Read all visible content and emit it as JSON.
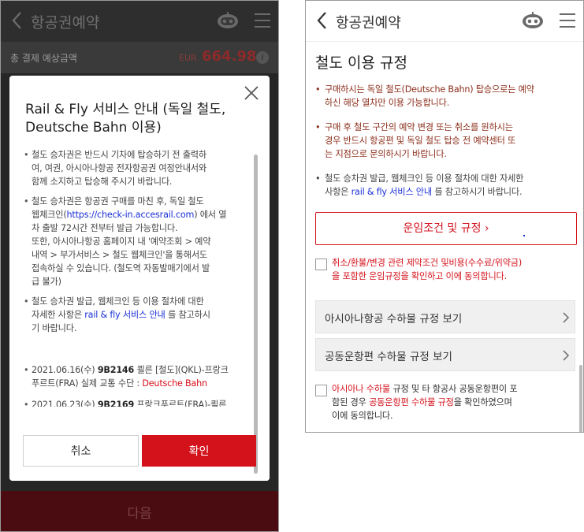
{
  "left_screen": {
    "header": {
      "title": "항공권예약"
    },
    "total": {
      "label": "총 결제 예상금액",
      "currency": "EUR",
      "amount": "664.98",
      "info_icon": "i"
    },
    "modal": {
      "title": "Rail & Fly 서비스 안내 (독일 철도, Deutsche Bahn 이용)",
      "items": [
        {
          "lines": [
            "철도 승차권은 반드시 기차에 탑승하기 전 출력하",
            "여, 여권, 아시아나항공 전자항공권 여정안내서와",
            "함께 소지하고 탑승해 주시기 바랍니다."
          ]
        },
        {
          "line1": "철도 승차권은 항공권 구매를 마친 후, 독일 철도",
          "line2_pre": "웹체크인(",
          "line2_link": "https://check-in.accesrail.com",
          "line2_post": ") 에서 열",
          "line3": "차 출발 72시간 전부터 발급 가능합니다.",
          "line4": "또한, 아시아나항공 홈페이지 내 '예약조회 > 예약",
          "line5": "내역 > 부가서비스 > 철도 웹체크인'을 통해서도",
          "line6": "접속하실 수 있습니다. (철도역 자동발매기에서 발",
          "line7": "급 불가)"
        },
        {
          "line1": "철도 승차권 발급, 웹체크인 등 이용 절차에 대한",
          "line2_pre": "자세한 사항은 ",
          "line2_link": "rail & fly 서비스 안내",
          "line2_post": " 를 참고하시",
          "line3": "기 바랍니다."
        }
      ],
      "flights": [
        {
          "date": "2021.06.16(수) ",
          "flight": "9B2146",
          "route1": " 쾰른 [철도](QKL)-프랑크",
          "route2_pre": "푸르트(FRA) 실제 교통 수단 : ",
          "carrier": "Deutsche Bahn"
        },
        {
          "date": "2021.06.23(수) ",
          "flight": "9B2169",
          "route1": " 프랑크푸르트(FRA)-쾰른"
        }
      ],
      "cancel_label": "취소",
      "confirm_label": "확인"
    },
    "next_label": "다음"
  },
  "right_screen": {
    "header": {
      "title": "항공권예약"
    },
    "section_title": "철도 이용 규정",
    "rules": [
      {
        "lines": [
          "구매하시는 독일 철도(Deutsche Bahn) 탑승으로는 예약",
          "하신 해당 열차만 이용 가능합니다."
        ]
      },
      {
        "lines": [
          "구매 후 철도 구간의 예약 변경 또는 취소를 원하시는",
          "경우 반드시 항공편 및 독일 철도 탑승 전 예약센터 또",
          "는 지점으로 문의하시기 바랍니다."
        ]
      },
      {
        "line1": "철도 승차권 발급, 웹체크인 등 이용 절차에 대한 자세한",
        "line2_pre": "사항은 ",
        "line2_link": "rail & fly 서비스 안내",
        "line2_post": " 를 참고하시기 바랍니다."
      }
    ],
    "fare_button_label": "운임조건 및 규정 ›",
    "agree1_lines": [
      "취소/환불/변경 관련 제약조건 및비용(수수료/위약금)",
      "을 포함한 운임규정을 확인하고 이에 동의합니다."
    ],
    "baggage_buttons": [
      {
        "label": "아시아나항공 수하물 규정 보기"
      },
      {
        "label": "공동운항편 수하물 규정 보기"
      }
    ],
    "agree2": {
      "red1": "아시아나 수하물",
      "text1": " 규정 및 타 항공사 공동운항편이 포",
      "text2": "함된 경우 ",
      "red2": "공동운항편 수하물 규정",
      "text3": "을 확인하였으며",
      "text4": "이에 동의합니다."
    }
  }
}
